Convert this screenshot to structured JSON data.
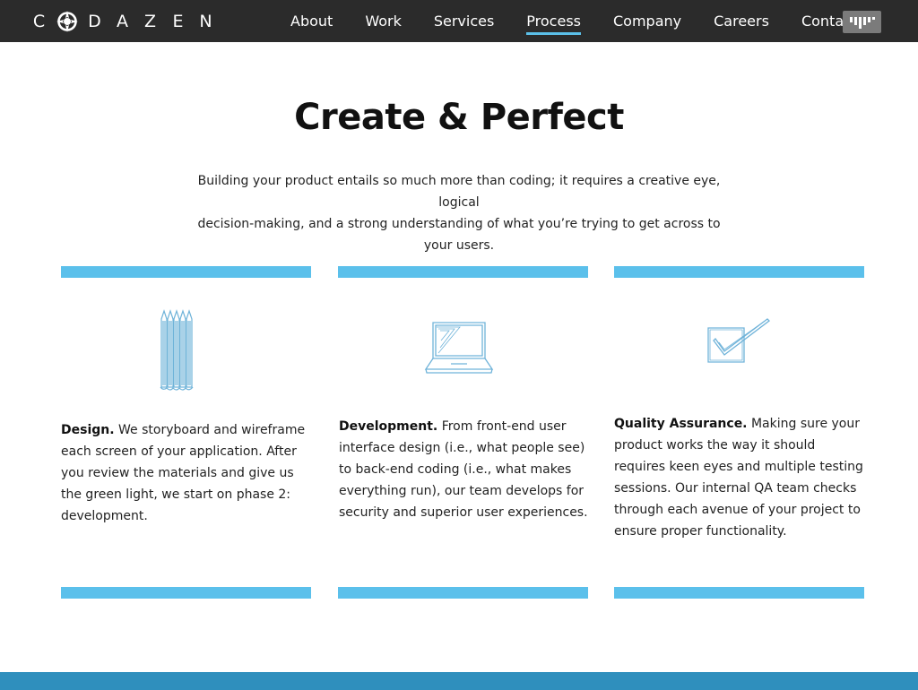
{
  "header": {
    "logo_letters": [
      "C",
      "D",
      "A",
      "Z",
      "E",
      "N"
    ],
    "nav": [
      {
        "label": "About",
        "active": false
      },
      {
        "label": "Work",
        "active": false
      },
      {
        "label": "Services",
        "active": false
      },
      {
        "label": "Process",
        "active": true
      },
      {
        "label": "Company",
        "active": false
      },
      {
        "label": "Careers",
        "active": false
      },
      {
        "label": "Contact",
        "active": false
      }
    ],
    "accent_color": "#5bbfe8",
    "background_color": "#2b2b2b"
  },
  "hero": {
    "title": "Create & Perfect",
    "intro_line1": "Building your product entails so much more than coding; it requires a creative eye, logical",
    "intro_line2": "decision-making, and a strong understanding of what you’re trying to get across to your users."
  },
  "columns": [
    {
      "icon": "pencils-icon",
      "heading": "Design.",
      "text": " We storyboard and wireframe each screen of your application. After you review the materials and give us the green light, we start on phase 2: development."
    },
    {
      "icon": "laptop-icon",
      "heading": "Development.",
      "text": " From front-end user interface design (i.e., what people see) to back-end coding (i.e., what makes everything run), our team develops for security and superior user experiences."
    },
    {
      "icon": "checkbox-icon",
      "heading": "Quality Assurance.",
      "text": " Making sure your product works the way it should requires keen eyes and multiple testing sessions. Our internal QA team checks through each avenue of your project to ensure proper functionality."
    }
  ],
  "colors": {
    "bar": "#5bc0eb",
    "footer": "#2f8fbd",
    "sketch": "#6fb3d9"
  }
}
